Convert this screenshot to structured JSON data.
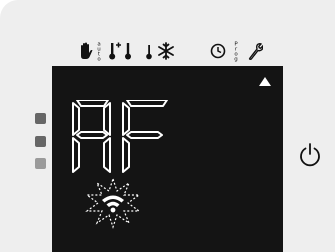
{
  "display": {
    "readout": "RF",
    "status_icon": "wifi-icon",
    "indicator": "triangle-up"
  },
  "mode_icons": [
    "hand-icon",
    "auto-icon",
    "temp-plus-icon",
    "temp-icon",
    "temp-low-icon",
    "snowflake-icon",
    "clock-icon",
    "prog-icon",
    "wrench-icon"
  ],
  "labels": {
    "auto": "auto",
    "prog": "Prog"
  },
  "colors": {
    "panel": "#eeeeee",
    "screen": "#141414",
    "segments": "#ffffff",
    "icons": "#111111"
  }
}
